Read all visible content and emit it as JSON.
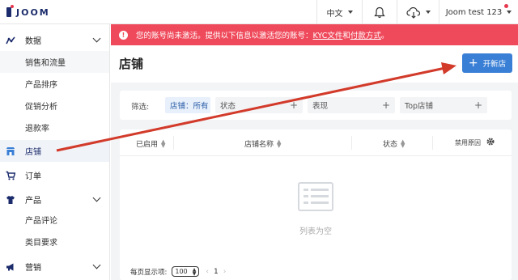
{
  "topbar": {
    "logo_text": "JOOM",
    "language": "中文",
    "user_name": "Joom test 123",
    "bell_icon": "bell-icon",
    "cloud_icon": "cloud-download-icon"
  },
  "sidebar": {
    "items": [
      {
        "label": "数据",
        "icon": "analytics-icon",
        "expandable": true
      },
      {
        "label": "销售和流量",
        "sub": true,
        "active_sub": true
      },
      {
        "label": "产品排序",
        "sub": true
      },
      {
        "label": "促销分析",
        "sub": true
      },
      {
        "label": "退款率",
        "sub": true
      },
      {
        "label": "店铺",
        "icon": "store-icon",
        "active": true
      },
      {
        "label": "订单",
        "icon": "cart-icon"
      },
      {
        "label": "产品",
        "icon": "shirt-icon",
        "expandable": true
      },
      {
        "label": "产品评论",
        "sub": true
      },
      {
        "label": "类目要求",
        "sub": true
      },
      {
        "label": "营销",
        "icon": "megaphone-icon",
        "expandable": true
      }
    ]
  },
  "alert": {
    "text_before": "您的账号尚未激活。提供以下信息以激活您的账号：",
    "link1": "KYC文件",
    "text_mid": "和",
    "link2": "付款方式",
    "text_after": "。",
    "color": "#ef4a5b"
  },
  "main": {
    "title": "店铺",
    "new_button": "开新店"
  },
  "filters": {
    "label": "筛选:",
    "chips": [
      {
        "label": "店铺：所有"
      },
      {
        "label": "状态"
      },
      {
        "label": "表现"
      },
      {
        "label": "Top店铺"
      }
    ]
  },
  "table": {
    "columns": [
      "已启用",
      "店铺名称",
      "状态",
      "禁用原因"
    ],
    "empty_text": "列表为空"
  },
  "pager": {
    "label": "每页显示项:",
    "page_size": "100",
    "page": "1"
  },
  "colors": {
    "accent": "#3a7fd6",
    "brand": "#1b2b6b",
    "annotation_arrow": "#d23a2a"
  }
}
